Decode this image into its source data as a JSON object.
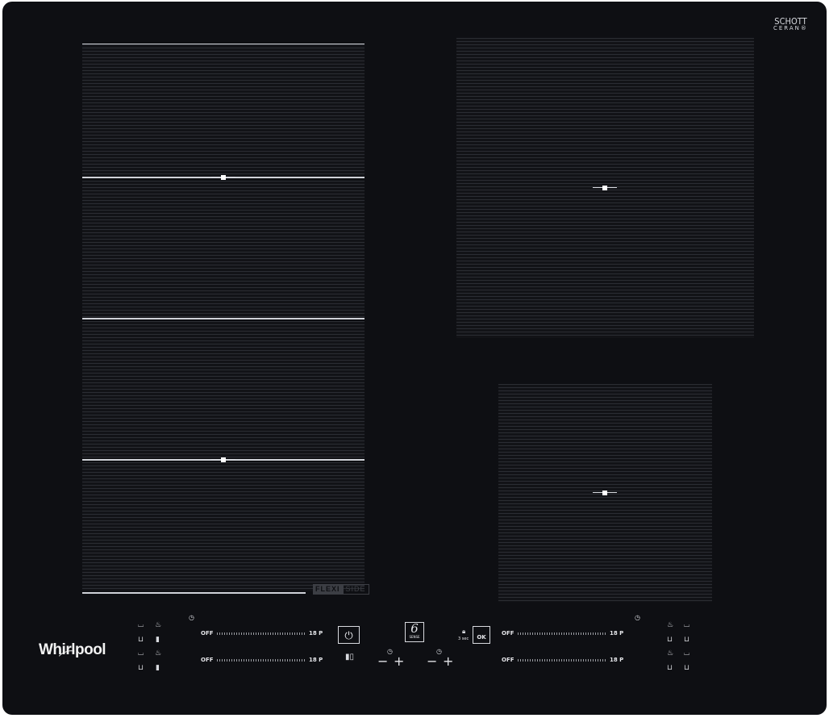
{
  "brand": {
    "schott_line1": "SCHOTT",
    "schott_line2": "CERAN®",
    "logo": "Whirlpool"
  },
  "flexi": {
    "part1": "FLEXI",
    "part2": "SIDE"
  },
  "sliders": {
    "left_top": {
      "off": "OFF",
      "max": "18 P"
    },
    "left_bottom": {
      "off": "OFF",
      "max": "18 P"
    },
    "right_top": {
      "off": "OFF",
      "max": "18 P"
    },
    "right_bottom": {
      "off": "OFF",
      "max": "18 P"
    }
  },
  "controls": {
    "ok_label": "OK",
    "lock_hint": "3 sec",
    "sense_number": "6",
    "sense_label": "SENSE",
    "minus": "−",
    "plus": "+"
  },
  "icons": {
    "power": "power-icon",
    "timer": "timer-icon",
    "lock": "lock-icon",
    "pot": "pot-icon",
    "bridge": "bridge-icon",
    "sixth_sense": "sixth-sense-icon"
  },
  "colors": {
    "glass": "#0e0f13",
    "line": "#cfd2d8",
    "text": "#e5e6ea"
  }
}
